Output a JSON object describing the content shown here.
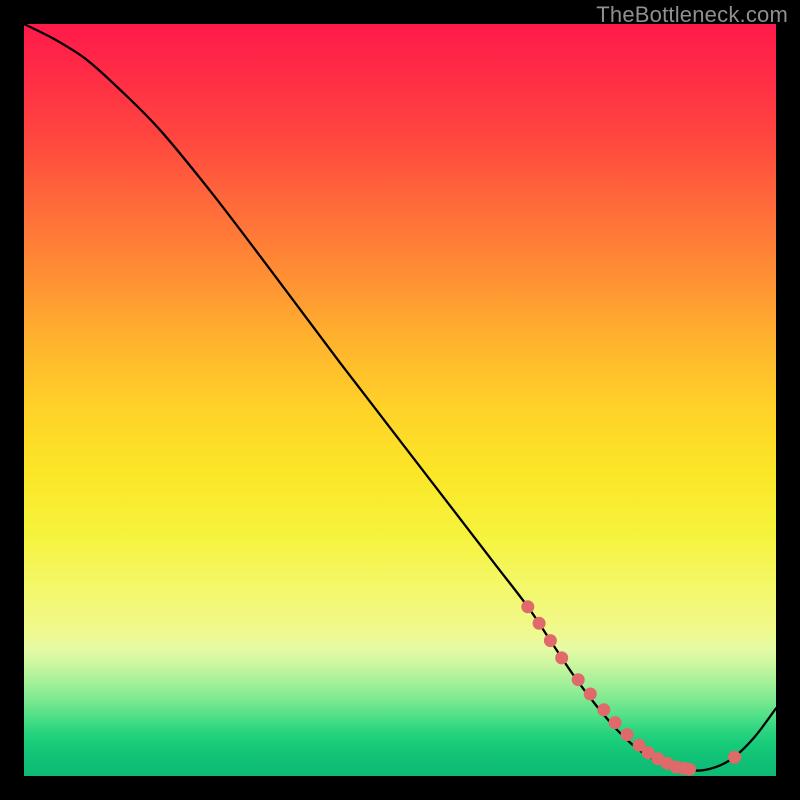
{
  "attribution": "TheBottleneck.com",
  "chart_data": {
    "type": "line",
    "title": "",
    "xlabel": "",
    "ylabel": "",
    "xlim": [
      0,
      100
    ],
    "ylim": [
      0,
      100
    ],
    "series": [
      {
        "name": "bottleneck-curve",
        "x": [
          0,
          4,
          8,
          12,
          18,
          25,
          33,
          42,
          52,
          62,
          67,
          70,
          73,
          76,
          79,
          82,
          85,
          88,
          91,
          94,
          97,
          100
        ],
        "y": [
          100,
          98,
          95.5,
          92,
          86,
          77.5,
          67,
          55,
          42,
          29,
          22.5,
          18,
          13.5,
          9.5,
          6,
          3.3,
          1.6,
          0.8,
          0.9,
          2.2,
          5,
          9
        ]
      }
    ],
    "scatter": {
      "name": "highlight-points",
      "color": "#e06a6a",
      "x": [
        67,
        68.5,
        70,
        71.5,
        73.7,
        75.3,
        77.1,
        78.6,
        80.2,
        81.8,
        83.0,
        84.3,
        85.5,
        86.7,
        87.8,
        88.5,
        94.5
      ],
      "y": [
        22.5,
        20.3,
        18.0,
        15.7,
        12.8,
        10.9,
        8.8,
        7.1,
        5.5,
        4.1,
        3.1,
        2.3,
        1.7,
        1.2,
        1.0,
        0.9,
        2.5
      ]
    },
    "background_gradient": {
      "type": "vertical",
      "stops": [
        {
          "pos": 0.0,
          "color": "#ff1a4b"
        },
        {
          "pos": 0.33,
          "color": "#ff8d34"
        },
        {
          "pos": 0.6,
          "color": "#fbe728"
        },
        {
          "pos": 0.8,
          "color": "#f0f98c"
        },
        {
          "pos": 0.9,
          "color": "#6fe68e"
        },
        {
          "pos": 1.0,
          "color": "#0ebb74"
        }
      ]
    }
  }
}
